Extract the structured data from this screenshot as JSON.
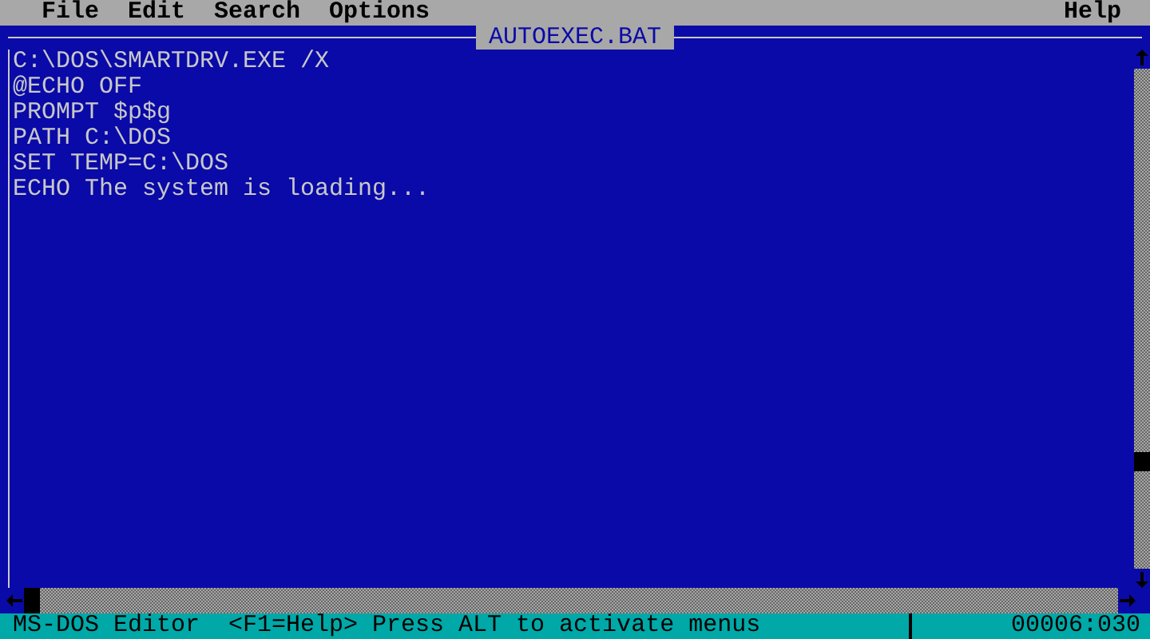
{
  "menu_bar": {
    "items": [
      "File",
      "Edit",
      "Search",
      "Options"
    ],
    "help": "Help"
  },
  "editor": {
    "title": "AUTOEXEC.BAT",
    "lines": [
      "C:\\DOS\\SMARTDRV.EXE /X",
      "@ECHO OFF",
      "PROMPT $p$g",
      "PATH C:\\DOS",
      "SET TEMP=C:\\DOS",
      "ECHO The system is loading..."
    ]
  },
  "status_bar": {
    "message": "MS-DOS Editor  <F1=Help> Press ALT to activate menus",
    "position": "00006:030"
  }
}
